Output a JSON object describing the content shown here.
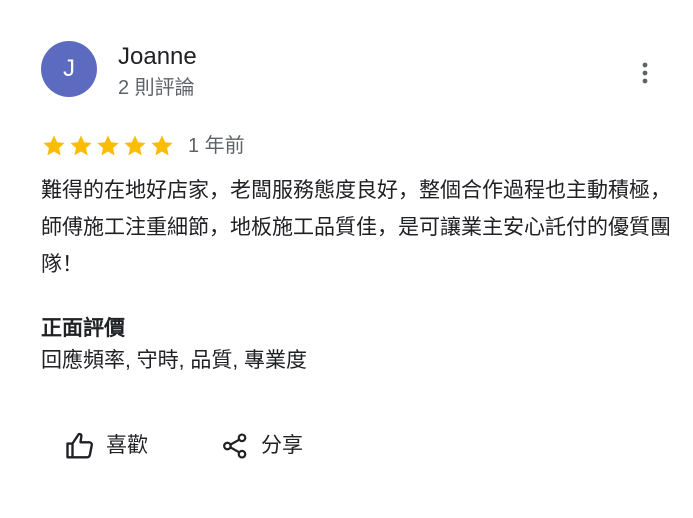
{
  "reviewer": {
    "avatar_initial": "J",
    "avatar_color": "#5c6bc0",
    "name": "Joanne",
    "meta": "2 則評論"
  },
  "menu": {
    "icon": "more-vert-icon"
  },
  "rating": {
    "stars": 5,
    "max_stars": 5,
    "star_color": "#fbbc04",
    "time": "1 年前"
  },
  "review": {
    "text": "難得的在地好店家，老闆服務態度良好，整個合作過程也主動積極，師傅施工注重細節，地板施工品質佳，是可讓業主安心託付的優質團隊！"
  },
  "highlights": {
    "heading": "正面評價",
    "tags": "回應頻率, 守時, 品質, 專業度"
  },
  "actions": {
    "like_label": "喜歡",
    "like_icon": "thumb-up-icon",
    "share_label": "分享",
    "share_icon": "share-icon"
  }
}
